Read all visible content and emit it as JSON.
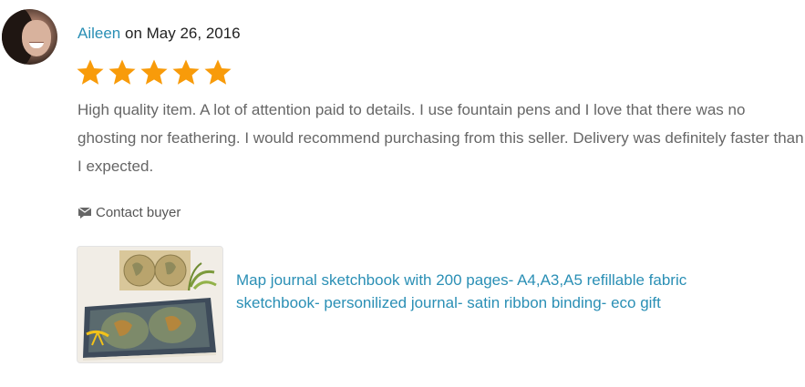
{
  "review": {
    "reviewer_name": "Aileen",
    "date_prefix": " on ",
    "date": "May 26, 2016",
    "rating": 5,
    "rating_max": 5,
    "text": "High quality item. A lot of attention paid to details. I use fountain pens and I love that there was no ghosting nor feathering. I would recommend purchasing from this seller. Delivery was definitely faster than I expected.",
    "contact_label": "Contact buyer",
    "contact_icon": "message-icon",
    "star_icon": "star-icon",
    "star_color": "#f89b0a",
    "link_color": "#2a8fb5"
  },
  "listing": {
    "title": "Map journal sketchbook with 200 pages- A4,A3,A5 refillable fabric sketchbook- personilized journal- satin ribbon binding- eco gift"
  }
}
